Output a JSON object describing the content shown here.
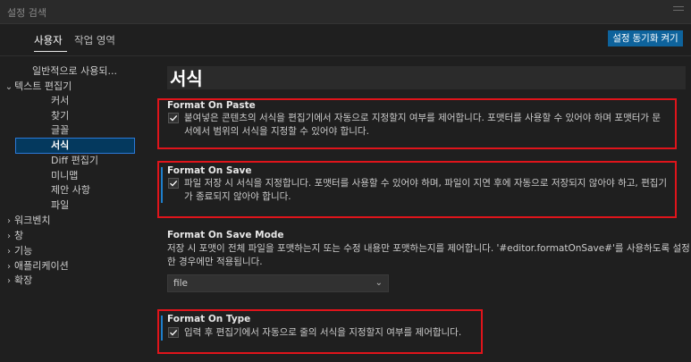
{
  "search": {
    "placeholder": "설정 검색"
  },
  "tabs": {
    "user": "사용자",
    "workspace": "작업 영역"
  },
  "sync_button": "설정 동기화 켜기",
  "tree": [
    {
      "label": "일반적으로 사용되...",
      "chevron": ""
    },
    {
      "label": "텍스트 편집기",
      "chevron": "⌄"
    },
    {
      "label": "커서",
      "chevron": ""
    },
    {
      "label": "찾기",
      "chevron": ""
    },
    {
      "label": "글꼴",
      "chevron": ""
    },
    {
      "label": "서식",
      "chevron": "",
      "selected": true
    },
    {
      "label": "Diff 편집기",
      "chevron": ""
    },
    {
      "label": "미니맵",
      "chevron": ""
    },
    {
      "label": "제안 사항",
      "chevron": ""
    },
    {
      "label": "파일",
      "chevron": ""
    },
    {
      "label": "워크벤치",
      "chevron": "›"
    },
    {
      "label": "창",
      "chevron": "›"
    },
    {
      "label": "기능",
      "chevron": "›"
    },
    {
      "label": "애플리케이션",
      "chevron": "›"
    },
    {
      "label": "확장",
      "chevron": "›"
    }
  ],
  "section_title": "서식",
  "settings": {
    "format_on_paste": {
      "title": "Format On Paste",
      "checked": true,
      "desc_line1": "붙여넣은 콘텐츠의 서식을 편집기에서 자동으로 지정할지 여부를 제어합니다. 포맷터를 사용할 수 있어야 하며 포맷터가 문",
      "desc_line2": "서에서 범위의 서식을 지정할 수 있어야 합니다."
    },
    "format_on_save": {
      "title": "Format On Save",
      "checked": true,
      "desc_line1": "파일 저장 시 서식을 지정합니다. 포맷터를 사용할 수 있어야 하며, 파일이 지연 후에 자동으로 저장되지 않아야 하고, 편집기",
      "desc_line2": "가 종료되지 않아야 합니다."
    },
    "format_on_save_mode": {
      "title": "Format On Save Mode",
      "desc_line1": "저장 시 포맷이 전체 파일을 포맷하는지 또는 수정 내용만 포맷하는지를 제어합니다. '#editor.formatOnSave#'를 사용하도록 설정",
      "desc_line2": "한 경우에만 적용됩니다.",
      "value": "file"
    },
    "format_on_type": {
      "title": "Format On Type",
      "checked": true,
      "desc_line1": "입력 후 편집기에서 자동으로 줄의 서식을 지정할지 여부를 제어합니다."
    }
  },
  "colors": {
    "accent": "#0e639c",
    "highlight_box": "#e0141b",
    "focus_bar": "#1e7fcc"
  }
}
